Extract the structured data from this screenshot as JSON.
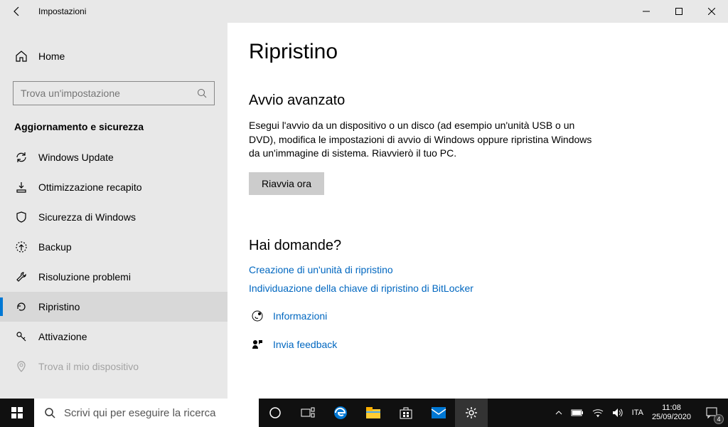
{
  "titlebar": {
    "title": "Impostazioni"
  },
  "sidebar": {
    "home": "Home",
    "search_placeholder": "Trova un'impostazione",
    "section": "Aggiornamento e sicurezza",
    "items": [
      {
        "label": "Windows Update"
      },
      {
        "label": "Ottimizzazione recapito"
      },
      {
        "label": "Sicurezza di Windows"
      },
      {
        "label": "Backup"
      },
      {
        "label": "Risoluzione problemi"
      },
      {
        "label": "Ripristino"
      },
      {
        "label": "Attivazione"
      },
      {
        "label": "Trova il mio dispositivo"
      }
    ]
  },
  "content": {
    "page_title": "Ripristino",
    "section_title": "Avvio avanzato",
    "section_desc": "Esegui l'avvio da un dispositivo o un disco (ad esempio un'unità USB o un DVD), modifica le impostazioni di avvio di Windows oppure ripristina Windows da un'immagine di sistema. Riavvierò il tuo PC.",
    "restart_button": "Riavvia ora",
    "help_title": "Hai domande?",
    "links": [
      "Creazione di un'unità di ripristino",
      "Individuazione della chiave di ripristino di BitLocker"
    ],
    "info_link": "Informazioni",
    "feedback_link": "Invia feedback"
  },
  "taskbar": {
    "search_placeholder": "Scrivi qui per eseguire la ricerca",
    "lang": "ITA",
    "time": "11:08",
    "date": "25/09/2020",
    "notif_count": "4"
  }
}
